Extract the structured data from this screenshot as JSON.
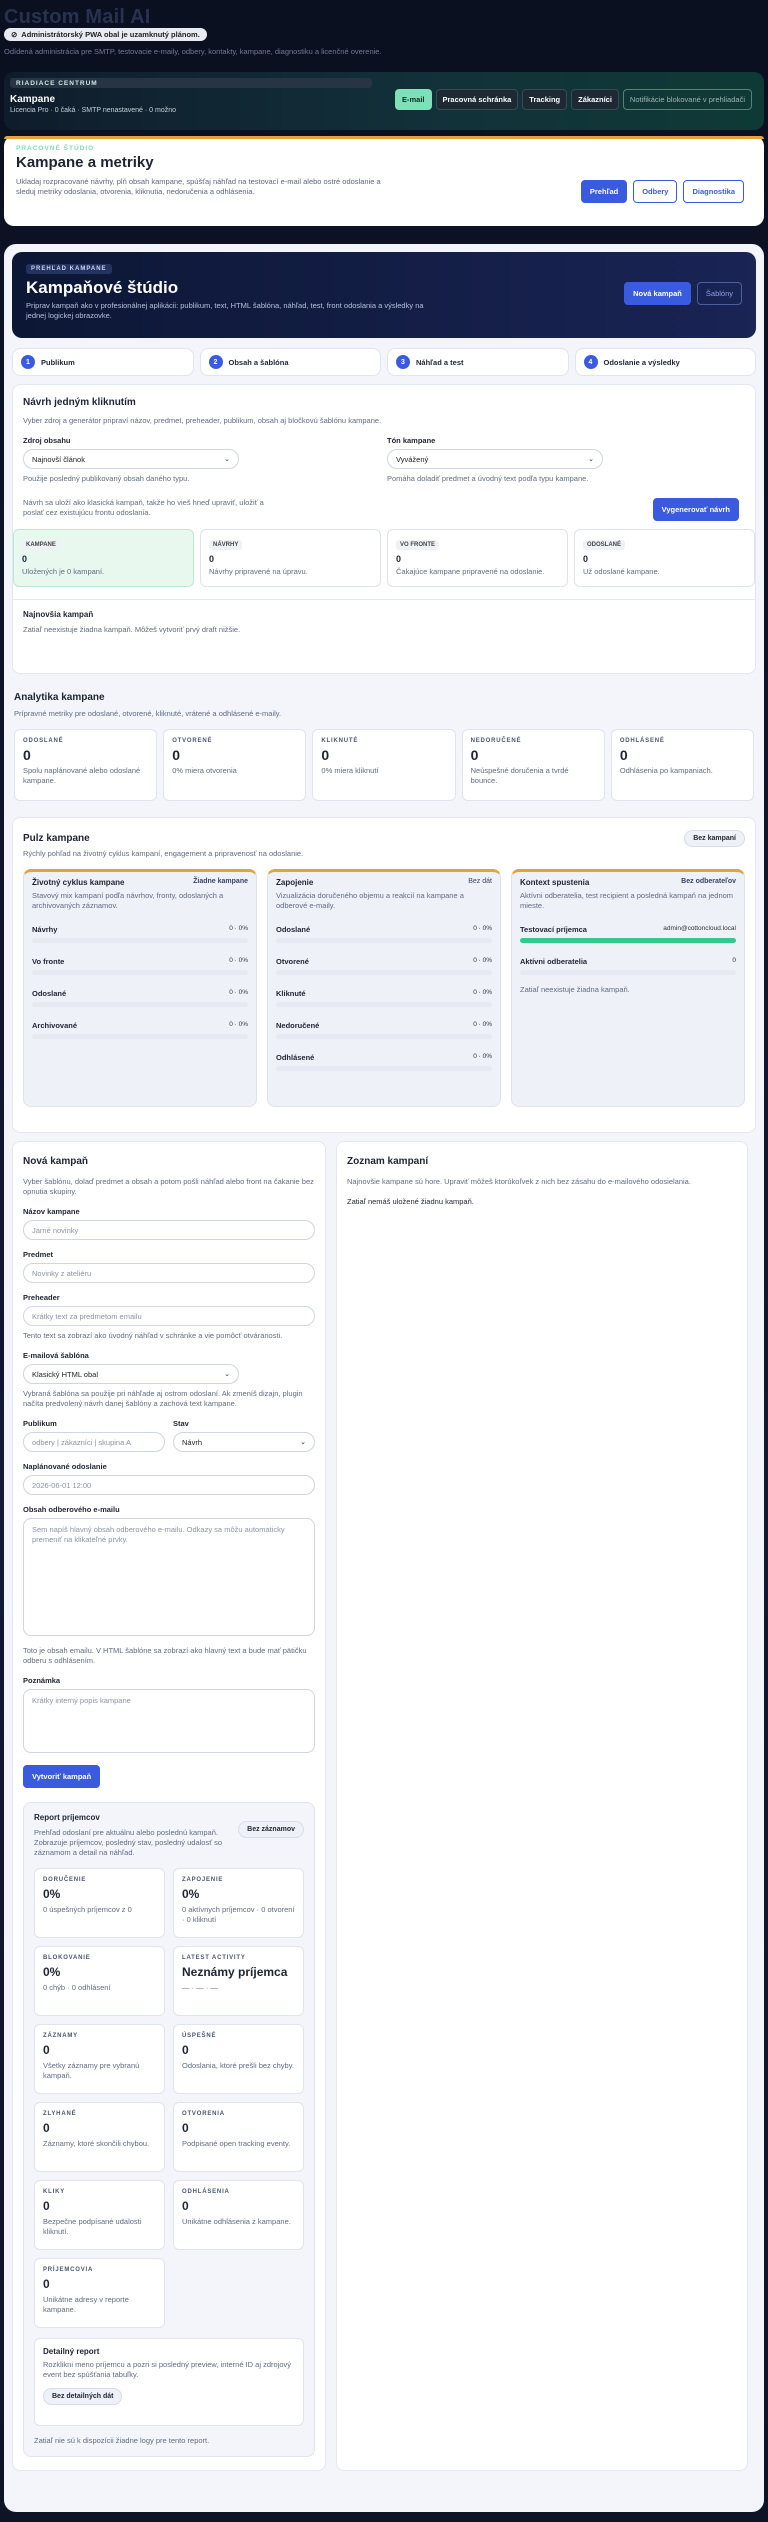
{
  "app_title": "Custom Mail AI",
  "pwa_pill": "Administrátorský PWA obal je uzamknutý plánom.",
  "header_sub": "Odídená administrácia pre SMTP, testovacie e-maily, odbery, kontakty, kampane, diagnostiku a licenčné overenie.",
  "bar": {
    "label": "RIADIACE CENTRUM",
    "title": "Kampane",
    "meta": "Licencia Pro · 0 čaká · SMTP nenastavené · 0 možno",
    "buttons": [
      "E-mail",
      "Pracovná schránka",
      "Tracking",
      "Zákazníci",
      "Notifikácie blokované v prehliadači"
    ]
  },
  "metrics": {
    "eyebrow": "PRACOVNÉ ŠTÚDIO",
    "title": "Kampane a metriky",
    "text": "Ukladaj rozpracované návrhy, plň obsah kampane, spúšťaj náhľad na testovací e-mail alebo ostré odoslanie a sleduj metriky odoslania, otvorenia, kliknutia, nedoručenia a odhlásenia.",
    "buttons": [
      "Prehľad",
      "Odbery",
      "Diagnostika"
    ]
  },
  "hero": {
    "tag": "PREHĽAD KAMPANE",
    "title": "Kampaňové štúdio",
    "text": "Priprav kampaň ako v profesionálnej aplikácii: publikum, text, HTML šablóna, náhľad, test, front odoslania a výsledky na jednej logickej obrazovke.",
    "btn_new": "Nová kampaň",
    "btn_tpl": "Šablóny"
  },
  "steps": [
    {
      "n": "1",
      "label": "Publikum"
    },
    {
      "n": "2",
      "label": "Obsah a šablóna"
    },
    {
      "n": "3",
      "label": "Náhľad a test"
    },
    {
      "n": "4",
      "label": "Odoslanie a výsledky"
    }
  ],
  "design": {
    "title": "Návrh jedným kliknutím",
    "text": "Vyber zdroj a generátor pripraví názov, predmet, preheader, publikum, obsah aj bločkovú šablónu kampane.",
    "source_label": "Zdroj obsahu",
    "source_value": "Najnovší článok",
    "source_hint": "Použije posledný publikovaný obsah daného typu.",
    "tone_label": "Tón kampane",
    "tone_value": "Vyvážený",
    "tone_hint": "Pomáha doladiť predmet a úvodný text podľa typu kampane.",
    "save_text": "Návrh sa uloží ako klasická kampaň, takže ho vieš hneď upraviť, uložiť a poslať cez existujúcu frontu odoslania.",
    "generate_btn": "Vygenerovať návrh",
    "stats": [
      {
        "k": "KAMPANE",
        "v": "0",
        "d": "Uložených je 0 kampaní."
      },
      {
        "k": "NÁVRHY",
        "v": "0",
        "d": "Návrhy pripravené na úpravu."
      },
      {
        "k": "VO FRONTE",
        "v": "0",
        "d": "Čakajúce kampane pripravené na odoslanie."
      },
      {
        "k": "ODOSLANÉ",
        "v": "0",
        "d": "Už odoslané kampane."
      }
    ],
    "latest_title": "Najnovšia kampaň",
    "latest_text": "Zatiaľ neexistuje žiadna kampaň. Môžeš vytvoriť prvý draft nižšie."
  },
  "analytics": {
    "title": "Analytika kampane",
    "text": "Prípravné metriky pre odoslané, otvorené, kliknuté, vrátené a odhlásené e-maily.",
    "cards": [
      {
        "k": "ODOSLANÉ",
        "v": "0",
        "d": "Spolu naplánované alebo odoslané kampane."
      },
      {
        "k": "OTVORENÉ",
        "v": "0",
        "d": "0% miera otvorenia"
      },
      {
        "k": "KLIKNUTÉ",
        "v": "0",
        "d": "0% miera kliknutí"
      },
      {
        "k": "NEDORUČENÉ",
        "v": "0",
        "d": "Neúspešné doručenia a tvrdé bounce."
      },
      {
        "k": "ODHLÁSENÉ",
        "v": "0",
        "d": "Odhlásenia po kampaniach."
      }
    ]
  },
  "pulse": {
    "title": "Pulz kampane",
    "text": "Rýchly pohľad na životný cyklus kampaní, engagement a pripravenosť na odoslanie.",
    "chip": "Bez kampaní",
    "life": {
      "title": "Životný cyklus kampane",
      "right": "Žiadne kampane",
      "desc": "Stavový mix kampaní podľa návrhov, fronty, odoslaných a archivovaných záznamov.",
      "rows": [
        {
          "t": "Návrhy",
          "n": "0 · 0%"
        },
        {
          "t": "Vo fronte",
          "n": "0 · 0%"
        },
        {
          "t": "Odoslané",
          "n": "0 · 0%"
        },
        {
          "t": "Archivované",
          "n": "0 · 0%"
        }
      ]
    },
    "eng": {
      "title": "Zapojenie",
      "right": "Bez dát",
      "desc": "Vizualizácia doručeného objemu a reakcií na kampane a odberové e-maily.",
      "rows": [
        {
          "t": "Odoslané",
          "n": "0 · 0%"
        },
        {
          "t": "Otvorené",
          "n": "0 · 0%"
        },
        {
          "t": "Kliknuté",
          "n": "0 · 0%"
        },
        {
          "t": "Nedoručené",
          "n": "0 · 0%"
        },
        {
          "t": "Odhlásené",
          "n": "0 · 0%"
        }
      ]
    },
    "ctx": {
      "title": "Kontext spustenia",
      "right": "Bez odberateľov",
      "desc": "Aktívni odberatelia, test recipient a posledná kampaň na jednom mieste.",
      "rows": [
        {
          "t": "Testovací príjemca",
          "n": "admin@cottoncloud.local",
          "fill": 1
        },
        {
          "t": "Aktívni odberatelia",
          "n": "0",
          "fill": 0
        }
      ],
      "note": "Zatiaľ neexistuje žiadna kampaň."
    }
  },
  "form": {
    "title": "Nová kampaň",
    "text": "Vyber šablónu, dolaď predmet a obsah a potom pošli náhľad alebo front na čakanie bez opnutia skupiny.",
    "name_label": "Názov kampane",
    "name_ph": "Jarné novinky",
    "subject_label": "Predmet",
    "subject_ph": "Novinky z ateliéru",
    "pre_label": "Preheader",
    "pre_ph": "Krátky text za predmetom emailu",
    "pre_hint": "Tento text sa zobrazí ako úvodný náhľad v schránke a vie pomôcť otváranosti.",
    "tpl_label": "E-mailová šablóna",
    "tpl_value": "Klasický HTML obal",
    "tpl_hint": "Vybraná šablóna sa použije pri náhľade aj ostrom odoslaní. Ak zmeníš dizajn, plugin načíta predvolený návrh danej šablóny a zachová text kampane.",
    "aud_label": "Publikum",
    "aud_ph": "odbery | zákazníci | skupina A",
    "state_label": "Stav",
    "state_value": "Návrh",
    "sched_label": "Naplánované odoslanie",
    "sched_value": "2026-06-01 12:00",
    "body_label": "Obsah odberového e-mailu",
    "body_ph": "Sem napíš hlavný obsah odberového e-mailu. Odkazy sa môžu automaticky premeniť na klikateľné prvky.",
    "body_hint": "Toto je obsah emailu. V HTML šablóne sa zobrazí ako hlavný text a bude mať pätičku odberu s odhlásením.",
    "note_label": "Poznámka",
    "note_ph": "Krátky interný popis kampane",
    "create_btn": "Vytvoriť kampaň"
  },
  "report": {
    "title": "Report príjemcov",
    "text": "Prehľad odoslaní pre aktuálnu alebo poslednú kampaň. Zobrazuje príjemcov, posledný stav, posledný udalosť so záznamom a detail na náhľad.",
    "chip": "Bez záznamov",
    "cards": [
      {
        "k": "DORUČENIE",
        "v": "0%",
        "d": "0 úspešných príjemcov z 0"
      },
      {
        "k": "ZAPOJENIE",
        "v": "0%",
        "d": "0 aktívnych príjemcov · 0 otvorení · 0 kliknutí"
      },
      {
        "k": "BLOKOVANIE",
        "v": "0%",
        "d": "0 chýb · 0 odhlásení"
      },
      {
        "k": "LATEST ACTIVITY",
        "v": "Neznámy príjemca",
        "d": "— · — · —"
      },
      {
        "k": "ZÁZNAMY",
        "v": "0",
        "d": "Všetky záznamy pre vybranú kampaň."
      },
      {
        "k": "ÚSPEŠNÉ",
        "v": "0",
        "d": "Odoslania, ktoré prešli bez chyby."
      },
      {
        "k": "ZLYHANÉ",
        "v": "0",
        "d": "Záznamy, ktoré skončili chybou."
      },
      {
        "k": "OTVORENIA",
        "v": "0",
        "d": "Podpisané open tracking eventy."
      },
      {
        "k": "KLIKY",
        "v": "0",
        "d": "Bezpečne podpísané udalosti kliknutí."
      },
      {
        "k": "ODHLÁSENIA",
        "v": "0",
        "d": "Unikátne odhlásenia z kampane."
      },
      {
        "k": "PRÍJEMCOVIA",
        "v": "0",
        "d": "Unikátne adresy v reporte kampane."
      }
    ],
    "detail_title": "Detailný report",
    "detail_text": "Rozklikni meno príjemcu a pozri si posledný preview, interné ID aj zdrojový event bez spúšťania tabuľky.",
    "detail_chip": "Bez detailných dát",
    "empty": "Zatiaľ nie sú k dispozícii žiadne logy pre tento report."
  },
  "list": {
    "title": "Zoznam kampaní",
    "text": "Najnovšie kampane sú hore. Upraviť môžeš ktorúkoľvek z nich bez zásahu do e-mailového odosielania.",
    "empty": "Zatiaľ nemáš uložené žiadnu kampaň."
  }
}
